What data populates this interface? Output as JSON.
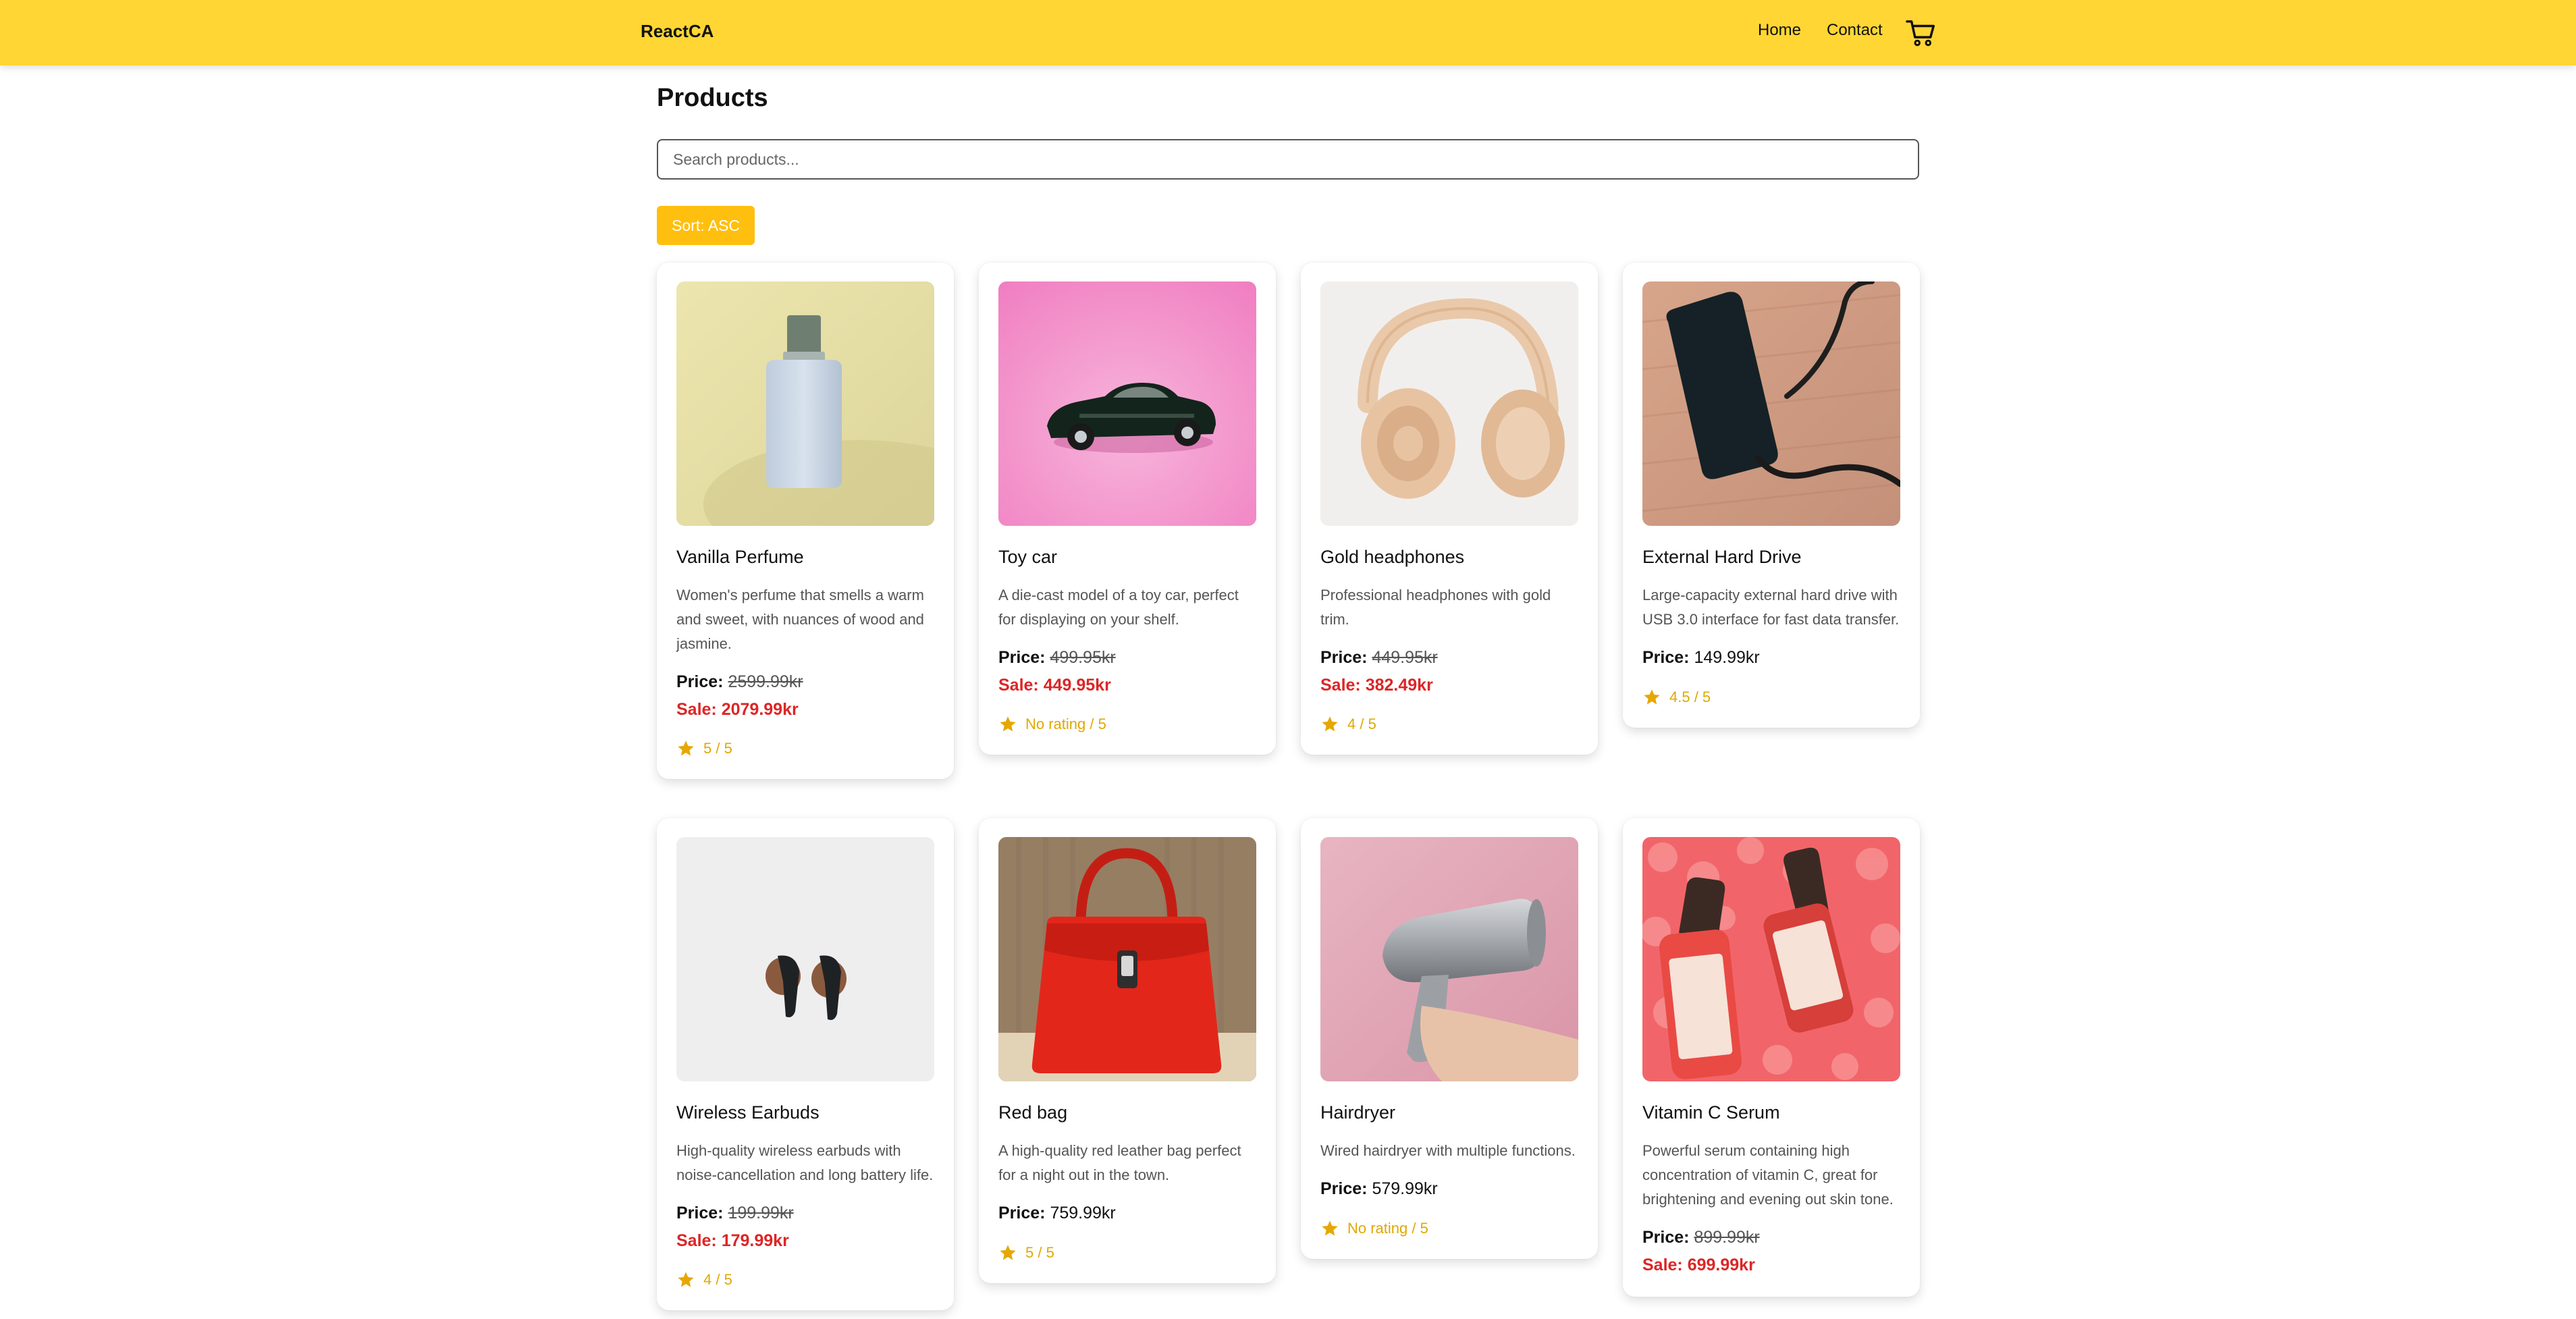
{
  "header": {
    "brand": "ReactCA",
    "nav": [
      "Home",
      "Contact"
    ],
    "cart_icon": "shopping-cart-icon",
    "background": "#FFD633"
  },
  "page": {
    "title": "Products",
    "search_placeholder": "Search products...",
    "sort_label": "Sort: ASC",
    "accent": "#FFBF0E",
    "sale_color": "#DC2626",
    "rating_color": "#E0A800"
  },
  "products": [
    {
      "name": "Vanilla Perfume",
      "description": "Women's perfume that smells a warm and sweet, with nuances of wood and jasmine.",
      "price_label": "Price:",
      "price": "2599.99kr",
      "sale": "Sale: 2079.99kr",
      "rating": "5 / 5"
    },
    {
      "name": "Toy car",
      "description": "A die-cast model of a toy car, perfect for displaying on your shelf.",
      "price_label": "Price:",
      "price": "499.95kr",
      "sale": "Sale: 449.95kr",
      "rating": "No rating / 5"
    },
    {
      "name": "Gold headphones",
      "description": "Professional headphones with gold trim.",
      "price_label": "Price:",
      "price": "449.95kr",
      "sale": "Sale: 382.49kr",
      "rating": "4 / 5"
    },
    {
      "name": "External Hard Drive",
      "description": "Large-capacity external hard drive with USB 3.0 interface for fast data transfer.",
      "price_label": "Price:",
      "price": "149.99kr",
      "sale": "",
      "rating": "4.5 / 5"
    },
    {
      "name": "Wireless Earbuds",
      "description": "High-quality wireless earbuds with noise-cancellation and long battery life.",
      "price_label": "Price:",
      "price": "199.99kr",
      "sale": "Sale: 179.99kr",
      "rating": "4 / 5"
    },
    {
      "name": "Red bag",
      "description": "A high-quality red leather bag perfect for a night out in the town.",
      "price_label": "Price:",
      "price": "759.99kr",
      "sale": "",
      "rating": "5 / 5"
    },
    {
      "name": "Hairdryer",
      "description": "Wired hairdryer with multiple functions.",
      "price_label": "Price:",
      "price": "579.99kr",
      "sale": "",
      "rating": "No rating / 5"
    },
    {
      "name": "Vitamin C Serum",
      "description": "Powerful serum containing high concentration of vitamin C, great for brightening and evening out skin tone.",
      "price_label": "Price:",
      "price": "899.99kr",
      "sale": "Sale: 699.99kr",
      "rating": ""
    }
  ]
}
